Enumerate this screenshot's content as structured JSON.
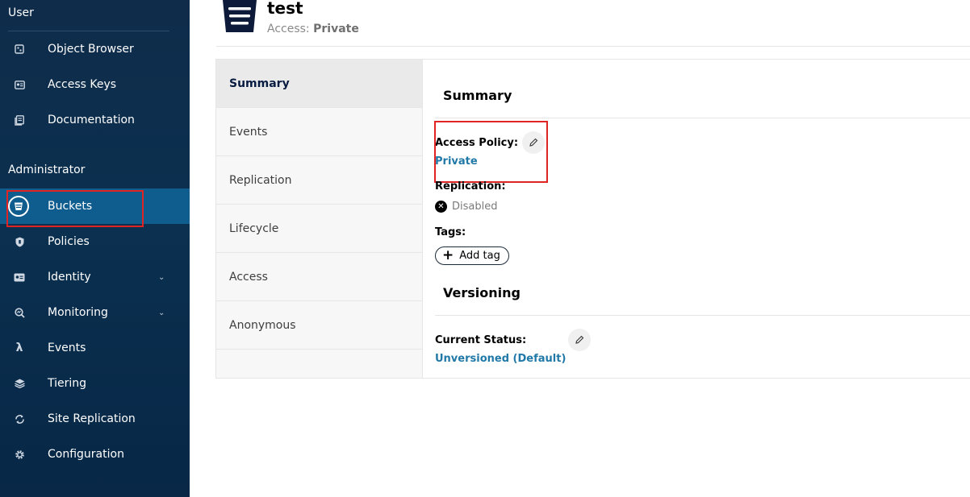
{
  "sidebar": {
    "user_section": "User",
    "admin_section": "Administrator",
    "user_items": [
      {
        "label": "Object Browser",
        "icon": "object-browser-icon"
      },
      {
        "label": "Access Keys",
        "icon": "access-keys-icon"
      },
      {
        "label": "Documentation",
        "icon": "documentation-icon"
      }
    ],
    "admin_items": [
      {
        "label": "Buckets",
        "icon": "buckets-icon",
        "active": true
      },
      {
        "label": "Policies",
        "icon": "policies-icon"
      },
      {
        "label": "Identity",
        "icon": "identity-icon",
        "expandable": true
      },
      {
        "label": "Monitoring",
        "icon": "monitoring-icon",
        "expandable": true
      },
      {
        "label": "Events",
        "icon": "lambda-icon"
      },
      {
        "label": "Tiering",
        "icon": "tiering-icon"
      },
      {
        "label": "Site Replication",
        "icon": "site-replication-icon"
      },
      {
        "label": "Configuration",
        "icon": "configuration-icon"
      }
    ]
  },
  "header": {
    "bucket_name": "test",
    "access_prefix": "Access:",
    "access_value": "Private"
  },
  "tabs": [
    {
      "label": "Summary",
      "active": true
    },
    {
      "label": "Events"
    },
    {
      "label": "Replication"
    },
    {
      "label": "Lifecycle"
    },
    {
      "label": "Access"
    },
    {
      "label": "Anonymous"
    }
  ],
  "summary": {
    "title": "Summary",
    "access_policy_label": "Access Policy:",
    "access_policy_value": "Private",
    "replication_label": "Replication:",
    "replication_value": "Disabled",
    "tags_label": "Tags:",
    "add_tag_label": "Add tag"
  },
  "versioning": {
    "title": "Versioning",
    "current_status_label": "Current Status:",
    "current_status_value": "Unversioned (Default)"
  },
  "colors": {
    "sidebar_bg": "#0b3050",
    "active_item": "#0f5c8f",
    "link": "#2179a8",
    "highlight": "#e02424"
  }
}
